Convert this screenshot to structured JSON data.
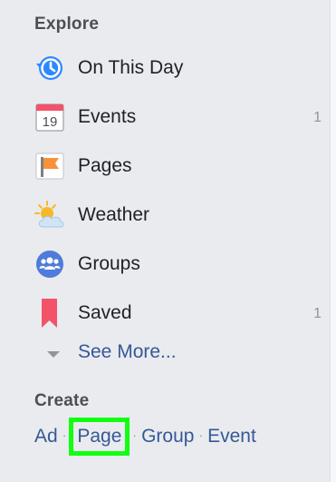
{
  "explore": {
    "title": "Explore",
    "items": [
      {
        "label": "On This Day",
        "icon": "on-this-day-icon",
        "count": ""
      },
      {
        "label": "Events",
        "icon": "calendar-icon",
        "calendar_day": "19",
        "count": "1"
      },
      {
        "label": "Pages",
        "icon": "flag-icon",
        "count": ""
      },
      {
        "label": "Weather",
        "icon": "weather-icon",
        "count": ""
      },
      {
        "label": "Groups",
        "icon": "groups-icon",
        "count": ""
      },
      {
        "label": "Saved",
        "icon": "bookmark-icon",
        "count": "1"
      }
    ],
    "see_more": "See More..."
  },
  "create": {
    "title": "Create",
    "links": [
      "Ad",
      "Page",
      "Group",
      "Event"
    ],
    "highlighted": "Page",
    "highlight_color": "#11ff11"
  },
  "colors": {
    "link": "#365899",
    "background": "#e9ebee",
    "text": "#1d2129",
    "muted": "#90949c"
  }
}
